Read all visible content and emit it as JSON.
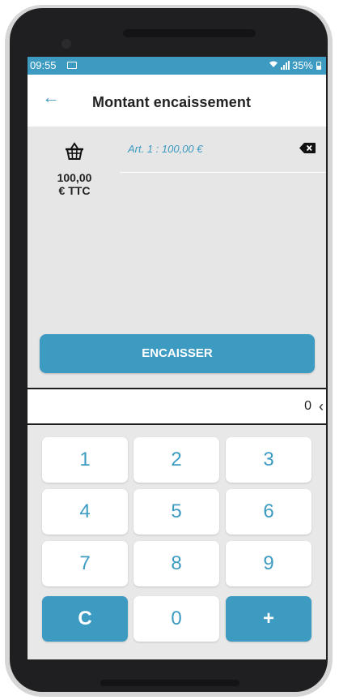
{
  "status_bar": {
    "time": "09:55",
    "battery": "35%"
  },
  "app_bar": {
    "title": "Montant encaissement"
  },
  "cart": {
    "total_amount": "100,00",
    "total_unit": "€ TTC",
    "article_line": "Art. 1 : 100,00 €"
  },
  "cash_button": {
    "label": "ENCAISSER"
  },
  "display": {
    "value": "0"
  },
  "keypad": {
    "keys": [
      "1",
      "2",
      "3",
      "4",
      "5",
      "6",
      "7",
      "8",
      "9",
      "C",
      "0",
      "+"
    ]
  },
  "colors": {
    "accent": "#3d9bc2",
    "background": "#e6e6e6",
    "phone_frame": "#1f1f21"
  }
}
